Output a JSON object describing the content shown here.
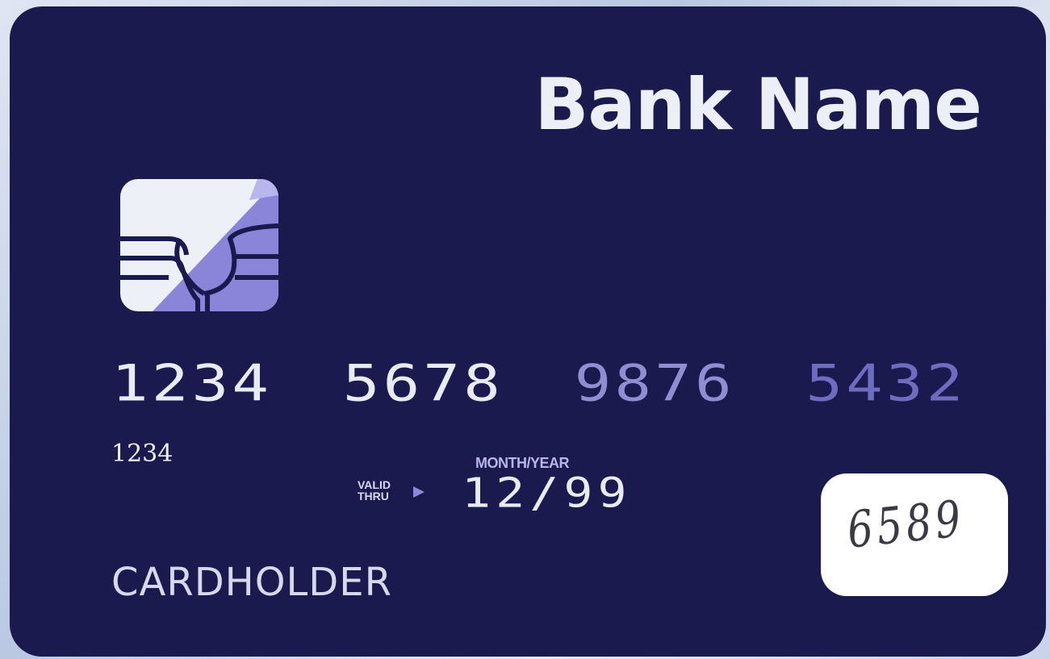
{
  "card": {
    "bank_name": "Bank Name",
    "number_groups": [
      "1234",
      "5678",
      "9876",
      "5432"
    ],
    "small_number": "1234",
    "month_year_label": "MONTH/YEAR",
    "valid_label_line1": "VALID",
    "valid_label_line2": "THRU",
    "expiry": "12/99",
    "cardholder": "CARDHOLDER",
    "security_code": "6589"
  },
  "colors": {
    "card_background": "#1b1a4e",
    "text_light": "#eceff6",
    "accent_lavender": "#8f8ed0",
    "chip_fill": "#eef0f8",
    "chip_accent": "#8a85d8"
  },
  "icons": {
    "chip": "emv-chip-icon",
    "arrow": "arrow-right-icon"
  }
}
